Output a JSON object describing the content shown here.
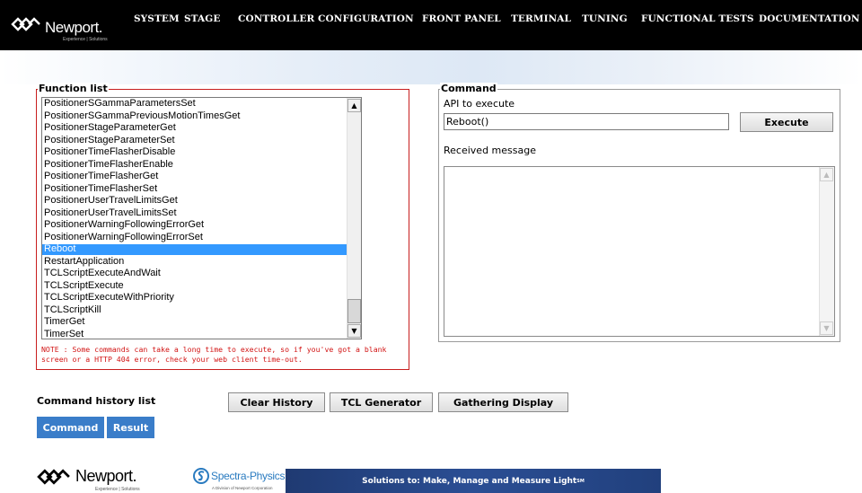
{
  "header": {
    "logo_text": "Newport.",
    "logo_tagline": "Experience | Solutions",
    "nav": [
      {
        "label": "SYSTEM"
      },
      {
        "label": "STAGE"
      },
      {
        "label": "CONTROLLER CONFIGURATION"
      },
      {
        "label": "FRONT PANEL"
      },
      {
        "label": "TERMINAL"
      },
      {
        "label": "TUNING"
      },
      {
        "label": "FUNCTIONAL TESTS"
      },
      {
        "label": "DOCUMENTATION"
      }
    ]
  },
  "function_list": {
    "legend": "Function list",
    "items": [
      "PositionerSGammaParametersSet",
      "PositionerSGammaPreviousMotionTimesGet",
      "PositionerStageParameterGet",
      "PositionerStageParameterSet",
      "PositionerTimeFlasherDisable",
      "PositionerTimeFlasherEnable",
      "PositionerTimeFlasherGet",
      "PositionerTimeFlasherSet",
      "PositionerUserTravelLimitsGet",
      "PositionerUserTravelLimitsSet",
      "PositionerWarningFollowingErrorGet",
      "PositionerWarningFollowingErrorSet",
      "Reboot",
      "RestartApplication",
      "TCLScriptExecuteAndWait",
      "TCLScriptExecute",
      "TCLScriptExecuteWithPriority",
      "TCLScriptKill",
      "TimerGet",
      "TimerSet"
    ],
    "selected": "Reboot",
    "note": "NOTE : Some commands can take a long time to execute, so if you've got a blank screen or a HTTP 404 error, check your web client time-out."
  },
  "command": {
    "legend": "Command",
    "api_label": "API to execute",
    "api_value": "Reboot()",
    "execute_label": "Execute",
    "received_label": "Received message",
    "received_value": ""
  },
  "history": {
    "label": "Command history list",
    "buttons": {
      "clear": "Clear History",
      "tcl": "TCL Generator",
      "gathering": "Gathering Display"
    },
    "tabs": {
      "command": "Command",
      "result": "Result"
    }
  },
  "footer": {
    "newport_text": "Newport.",
    "newport_tagline": "Experience | Solutions",
    "spectra_text": "Spectra-Physics",
    "spectra_tagline": "A Division of Newport Corporation",
    "banner_text": "Solutions to: Make, Manage and Measure Light",
    "banner_mark": "SM"
  },
  "colors": {
    "header_bg": "#000000",
    "selection": "#3399ff",
    "tab_bg": "#3a7dc9",
    "note_red": "#d21414",
    "banner_bg": "#21407d"
  },
  "icons": [
    "newport-logo-icon",
    "spectra-physics-logo-icon",
    "scroll-up-arrow-icon",
    "scroll-down-arrow-icon"
  ]
}
